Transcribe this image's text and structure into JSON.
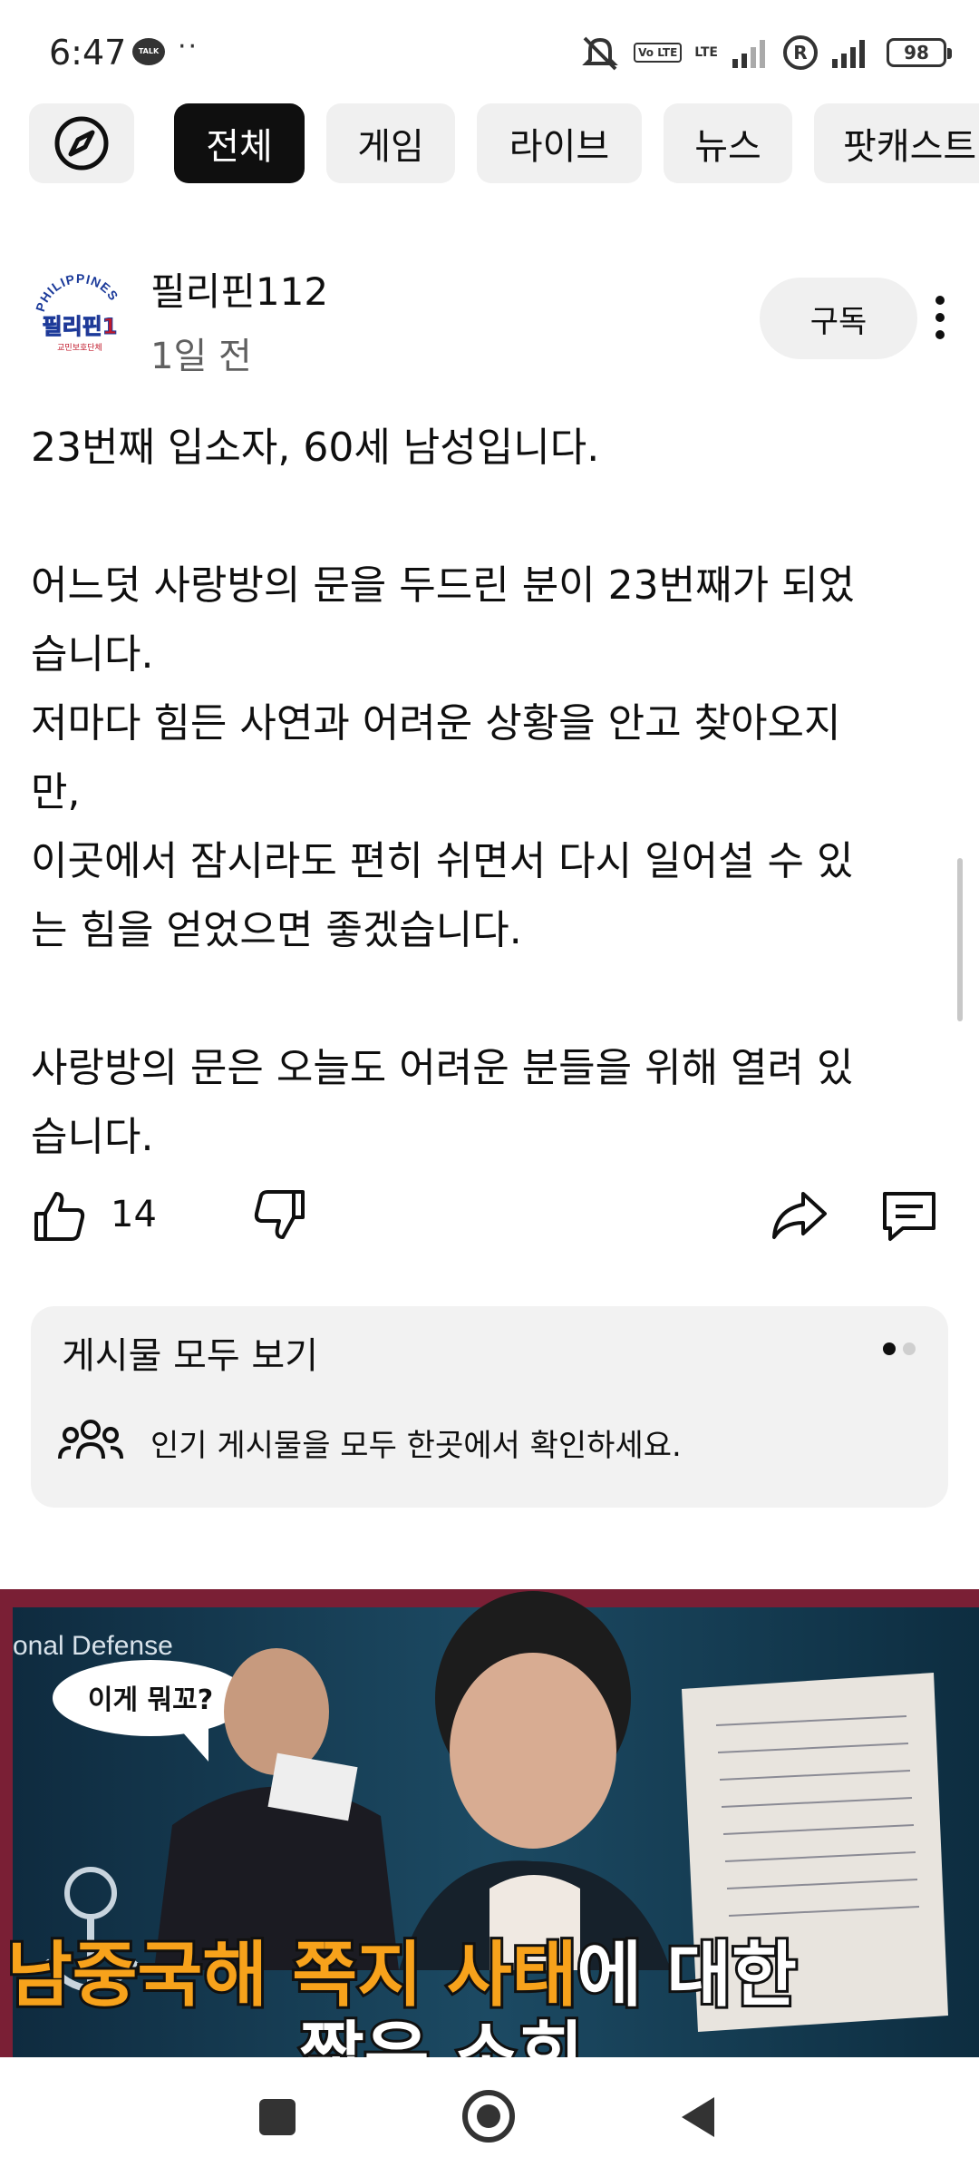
{
  "status_bar": {
    "time": "6:47",
    "talk_badge": "TALK",
    "overflow": "··",
    "volte": "Vo LTE",
    "lte": "LTE",
    "registered_mark": "R",
    "battery": "98"
  },
  "chips": [
    {
      "label": "전체",
      "active": true
    },
    {
      "label": "게임",
      "active": false
    },
    {
      "label": "라이브",
      "active": false
    },
    {
      "label": "뉴스",
      "active": false
    },
    {
      "label": "팟캐스트",
      "active": false
    }
  ],
  "post": {
    "channel_name": "필리핀112",
    "avatar_text_top": "PHILIPPINES",
    "avatar_text_main": "필리핀1",
    "avatar_text_sub": "교민보호단체",
    "time_ago": "1일 전",
    "subscribe_label": "구독",
    "body": "23번째 입소자, 60세 남성입니다.\n\n어느덧 사랑방의 문을 두드린 분이 23번째가 되었\n습니다.\n저마다 힘든 사연과 어려운 상황을 안고 찾아오지\n만,\n이곳에서 잠시라도 편히 쉬면서 다시 일어설 수 있\n는 힘을 얻었으면 좋겠습니다.\n\n사랑방의 문은 오늘도 어려운 분들을 위해 열려 있\n습니다.",
    "like_count": "14"
  },
  "see_all_card": {
    "title": "게시물 모두 보기",
    "description": "인기 게시물을 모두 한곳에서 확인하세요."
  },
  "thumbnail": {
    "top_label": "onal Defense",
    "speech_bubble": "이게 뭐꼬?",
    "headline_orange_1": "남중국해 쪽지 사태",
    "headline_white": "에 대한",
    "headline_line2": "짧은 소회"
  },
  "colors": {
    "chip_active_bg": "#0f0f0f",
    "chip_bg": "#f0f0f0",
    "secondary_text": "#606060",
    "card_bg": "#f2f2f2",
    "headline_orange": "#f7a21b"
  }
}
